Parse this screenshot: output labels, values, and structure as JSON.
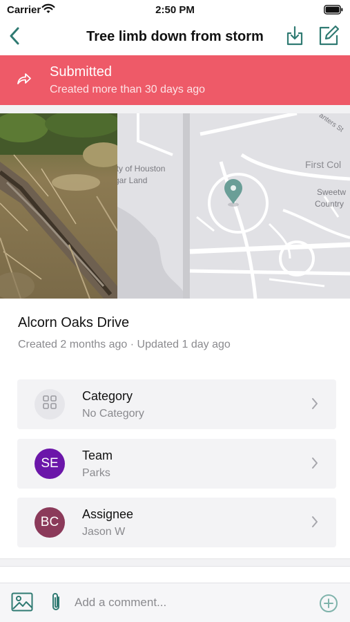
{
  "status_bar": {
    "carrier": "Carrier",
    "time": "2:50 PM"
  },
  "nav": {
    "title": "Tree limb down from storm",
    "back_icon": "chevron-left-icon",
    "download_icon": "download-icon",
    "edit_icon": "edit-icon"
  },
  "banner": {
    "status": "Submitted",
    "subtitle": "Created more than 30 days ago",
    "color": "#ee5a68",
    "icon": "share-arrow-icon"
  },
  "map": {
    "labels": [
      "City of Houston",
      "Sugar Land",
      "First Colony",
      "Sweetwater",
      "Country",
      "Lantern St"
    ],
    "pin_color": "#6a9e97"
  },
  "report": {
    "location": "Alcorn Oaks Drive",
    "meta": "Created 2 months ago · Updated 1 day ago"
  },
  "details": [
    {
      "title": "Category",
      "value": "No Category",
      "avatar_text": "",
      "icon": "grid-icon",
      "avatar_color": "#e6e6ea"
    },
    {
      "title": "Team",
      "value": "Parks",
      "avatar_text": "SE",
      "avatar_color": "#6b16a9"
    },
    {
      "title": "Assignee",
      "value": "Jason W",
      "avatar_text": "BC",
      "avatar_color": "#8b3a5a"
    }
  ],
  "comment": {
    "placeholder": "Add a comment...",
    "value": ""
  },
  "colors": {
    "accent": "#2f7a72",
    "banner": "#ee5a68"
  }
}
